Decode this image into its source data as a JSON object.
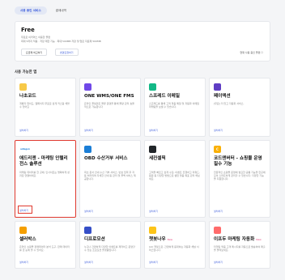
{
  "tabs": [
    {
      "label": "사용 중인 서비스",
      "active": true
    },
    {
      "label": "결제내역",
      "active": false
    }
  ],
  "plan": {
    "title": "Free",
    "desc_line1": "무료로 이커머스 이용한 플랜",
    "desc_line2": "최대 5까지 적용 · 저장 제한 기능 · 최대 500MB 저장 및 업로 자료제 500MB",
    "button_1": "요금제 비교하기",
    "button_2": "변경요청하기",
    "side_link": "현재 사용 중인 플랜 ☐"
  },
  "section_title": "사용 가능한 앱",
  "install_label": "설치하기",
  "apps": [
    {
      "name": "나초코드",
      "icon_color": "#f7c948",
      "icon_text": "",
      "new": false,
      "desc": "개발자 없이도, 웹페이지 무료로 쉽게 커스텀 해볼 수 있어요",
      "highlight": false
    },
    {
      "name": "ONE WMS/ONE FMS",
      "icon_color": "#7048e8",
      "icon_text": "",
      "new": false,
      "desc": "온라인 풀필먼트 물류 운영을 통해 물량 관리 효율적으로 가능합니다",
      "highlight": false
    },
    {
      "name": "스프레드 이메일",
      "icon_color": "#12b886",
      "icon_text": "",
      "new": false,
      "desc": "스프레드를 통해 고객 맞춤 메일 및 자동화 이메일 마케팅을 보낼 수 있습니다.",
      "highlight": false
    },
    {
      "name": "페이액션",
      "icon_color": "#5f3dc4",
      "icon_text": "",
      "new": false,
      "desc": "[무료] 더 있고 자동화 서비스.",
      "highlight": false
    },
    {
      "name": "애드리젠 - 마케팅 인텔리전스 솔루션",
      "icon_color": "#ffffff",
      "icon_text": "adlegen",
      "new": false,
      "desc": "마케팅 데이터를 한 곳에, 인사이트는 명확하게 성과로 연결하세요.",
      "highlight": true
    },
    {
      "name": "OBD 수산거부 서비스",
      "icon_color": "#1c7ed6",
      "icon_text": "",
      "new": false,
      "desc": "최초 문서 안내 수신 거부 서비스. 번호 입력 후 자동 처리되며 자세한 안내 등 관리 및 콜백 서비스 제공합니다.",
      "highlight": false
    },
    {
      "name": "세컨셀픽",
      "icon_color": "#212529",
      "icon_text": "",
      "new": false,
      "desc": "고객을 빠르고 쉽게 수집, 이벤트 진행하고 리워드, 응원 등 다양한 방법으로 셀럽 맞춤 목표 관리 해보세요.",
      "highlight": false
    },
    {
      "name": "코드앤버터 - 쇼핑몰 운영 필수 기능",
      "icon_color": "#fab005",
      "icon_text": "C",
      "new": false,
      "desc": "전문적인 쇼핑몰 운영에 필요한 공통 기능을 한곳에 모아 스마트하게 관리할 수 있습니다. 다양한 기능을 지원합니다.",
      "highlight": false
    },
    {
      "name": "셀러박스",
      "icon_color": "#f59f00",
      "icon_text": "",
      "new": false,
      "desc": "온라인 쇼핑몰 판매데이터 분석 도구, 판매 데이터를 한 눈에 볼 수 있어요.",
      "highlight": false
    },
    {
      "name": "디프로모션",
      "icon_color": "#364fc7",
      "icon_text": "",
      "new": false,
      "desc": "누구나 간편하게 다양한 이벤트를 제작하고 운영할 수 있는 프로모션 플랫폼입니다.",
      "highlight": false
    },
    {
      "name": "챗봇나우",
      "icon_color": "#fcc419",
      "icon_text": "",
      "new": true,
      "desc": "[AI] 챗봇으로, 간편하게 응대하는 자동화 채널 서비스입니다.",
      "highlight": false
    },
    {
      "name": "이프두 마케팅 자동화",
      "icon_color": "#ff6b6b",
      "icon_text": "",
      "new": true,
      "desc": "타겟팅 맞춤 고객 메시지를 자동으로 발송하여 매출을 올려보세요.",
      "highlight": false
    }
  ],
  "new_label": "New"
}
